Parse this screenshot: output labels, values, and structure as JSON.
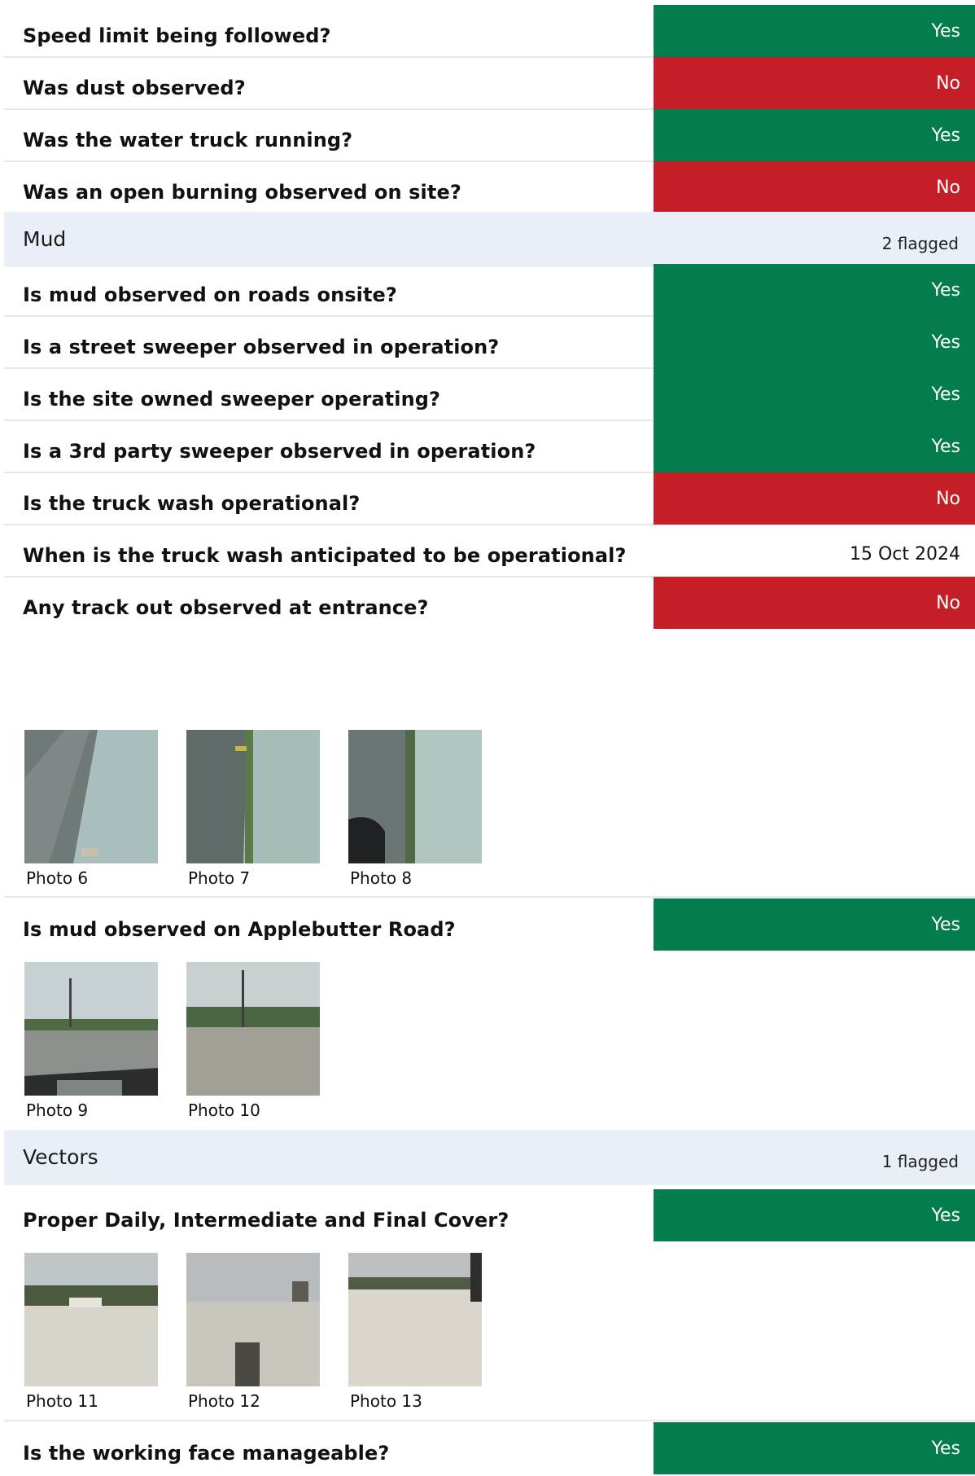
{
  "items_top": [
    {
      "question": "Speed limit being followed?",
      "answer": "Yes",
      "status": "yes"
    },
    {
      "question": "Was dust observed?",
      "answer": "No",
      "status": "no"
    },
    {
      "question": "Was the water truck running?",
      "answer": "Yes",
      "status": "yes"
    },
    {
      "question": "Was an open burning observed on site?",
      "answer": "No",
      "status": "no"
    }
  ],
  "section_mud": {
    "title": "Mud",
    "flagged": "2 flagged"
  },
  "items_mud": [
    {
      "question": "Is mud observed  on roads onsite?",
      "answer": "Yes",
      "status": "yes"
    },
    {
      "question": "Is a street sweeper observed in operation?",
      "answer": "Yes",
      "status": "yes"
    },
    {
      "question": "Is the site owned sweeper operating?",
      "answer": "Yes",
      "status": "yes"
    },
    {
      "question": "Is a 3rd party sweeper observed in operation?",
      "answer": "Yes",
      "status": "yes"
    },
    {
      "question": "Is the truck wash operational?",
      "answer": "No",
      "status": "no"
    },
    {
      "question": "When is the truck wash anticipated to be operational?",
      "answer": "15 Oct 2024",
      "status": "plain"
    },
    {
      "question": "Any track out observed at entrance?",
      "answer": "No",
      "status": "no"
    }
  ],
  "photos_trackout": [
    "Photo 6",
    "Photo 7",
    "Photo 8"
  ],
  "item_applebutter": {
    "question": "Is mud observed on Applebutter Road?",
    "answer": "Yes",
    "status": "yes"
  },
  "photos_applebutter": [
    "Photo 9",
    "Photo 10"
  ],
  "section_vectors": {
    "title": "Vectors",
    "flagged": "1 flagged"
  },
  "item_cover": {
    "question": "Proper Daily, Intermediate and Final Cover?",
    "answer": "Yes",
    "status": "yes"
  },
  "photos_cover": [
    "Photo 11",
    "Photo 12",
    "Photo 13"
  ],
  "item_working_face": {
    "question": "Is the working face manageable?",
    "answer": "Yes",
    "status": "yes"
  },
  "colors": {
    "yes": "#037d4e",
    "no": "#c41e26",
    "section_bg": "#e9eef7",
    "divider": "#e3e7ee"
  }
}
